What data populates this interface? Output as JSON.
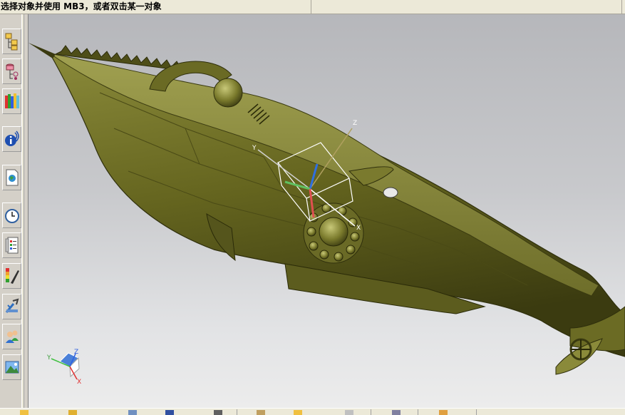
{
  "cue_line": {
    "prompt": "选择对象并使用 MB3，或者双击某一对象",
    "status": ""
  },
  "resource_bar": {
    "items": [
      {
        "name": "assembly-navigator",
        "icon": "assembly-navigator-icon"
      },
      {
        "name": "part-navigator",
        "icon": "part-navigator-icon"
      },
      {
        "name": "reuse-library",
        "icon": "library-books-icon"
      },
      {
        "name": "hd3d-tools",
        "icon": "info-signal-icon"
      },
      {
        "name": "web-browser",
        "icon": "globe-page-icon"
      },
      {
        "name": "history",
        "icon": "clock-icon"
      },
      {
        "name": "process-studio",
        "icon": "checklist-icon"
      },
      {
        "name": "visualization",
        "icon": "color-palette-icon"
      },
      {
        "name": "roles-tools",
        "icon": "tools-icon"
      },
      {
        "name": "roles",
        "icon": "user-roles-icon"
      },
      {
        "name": "system-scenes",
        "icon": "landscape-icon"
      }
    ]
  },
  "viewport": {
    "model": "submarine-model",
    "wcs_triad": {
      "x": "X",
      "y": "Y",
      "z": "Z"
    },
    "view_triad": {
      "x": "X",
      "y": "Y",
      "z": "Z"
    },
    "colors": {
      "hull": "#6b6b24",
      "hull_light": "#8b8b3c",
      "hull_dark": "#3e3e12",
      "triad_x": "#e03030",
      "triad_y": "#40c040",
      "triad_z": "#3060e0"
    }
  }
}
